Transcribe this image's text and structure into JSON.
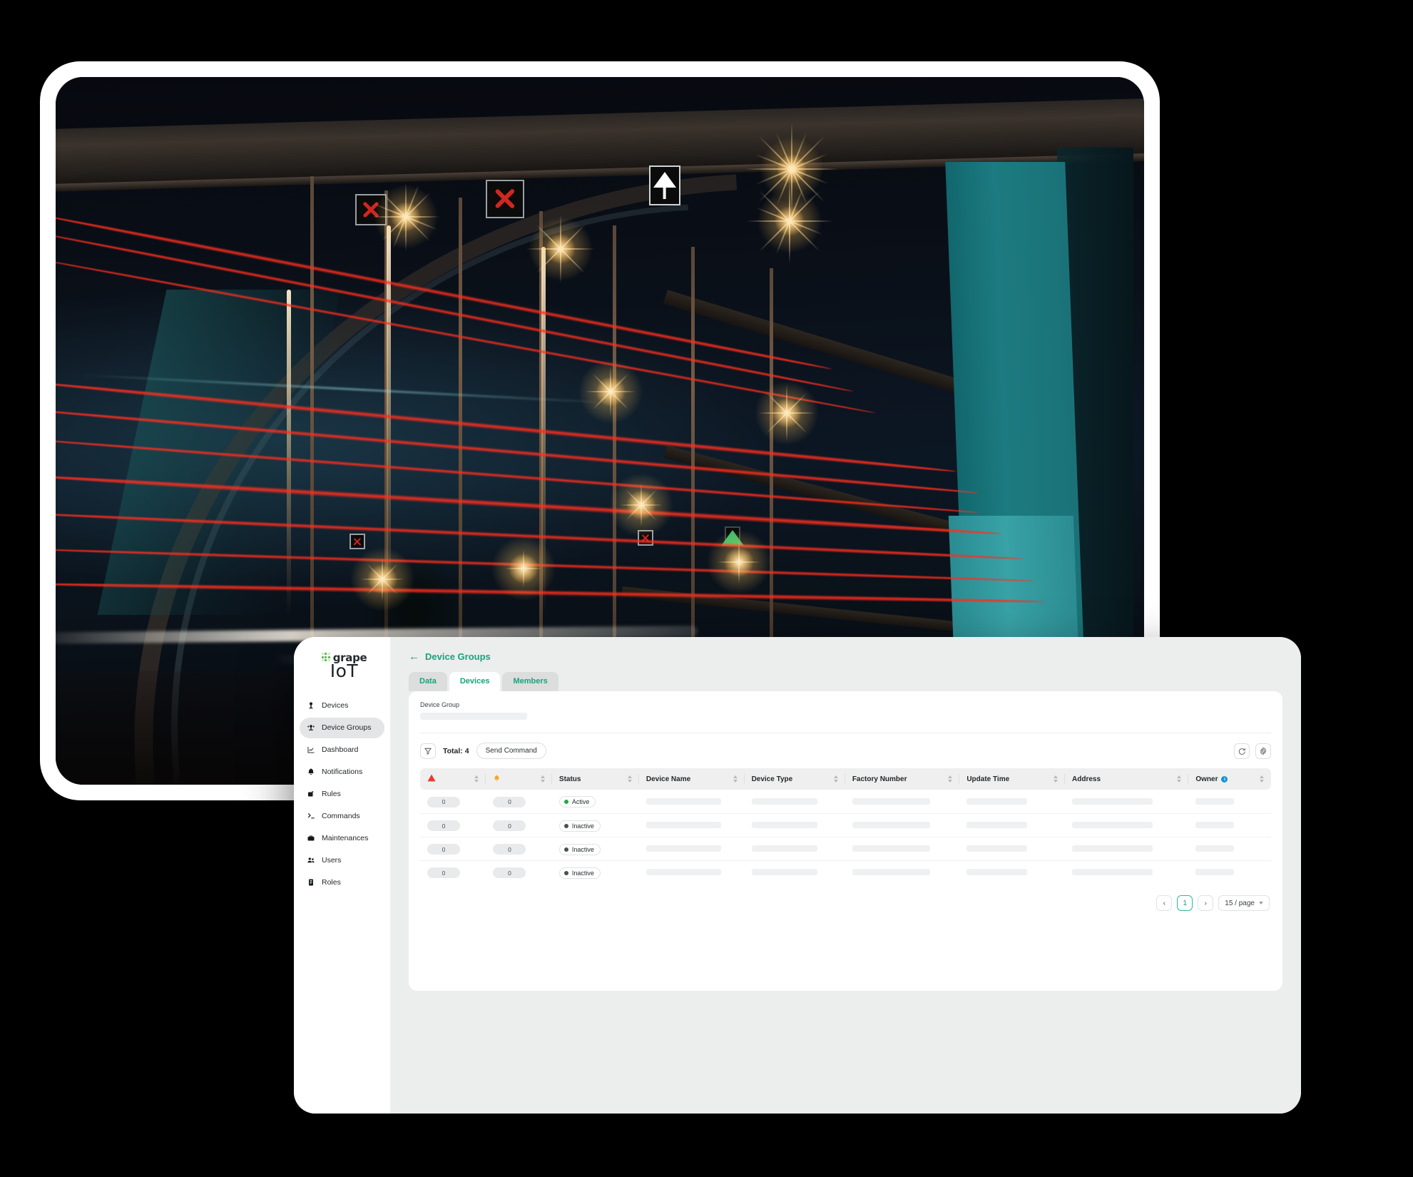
{
  "app": {
    "logo": {
      "word": "grape",
      "product": "IoT",
      "dot_color": "#5bbd4e"
    },
    "accent": "#17a47c"
  },
  "sidebar": {
    "items": [
      {
        "label": "Devices",
        "icon": "device-icon",
        "active": false
      },
      {
        "label": "Device Groups",
        "icon": "device-groups-icon",
        "active": true
      },
      {
        "label": "Dashboard",
        "icon": "chart-icon",
        "active": false
      },
      {
        "label": "Notifications",
        "icon": "bell-icon",
        "active": false
      },
      {
        "label": "Rules",
        "icon": "rules-icon",
        "active": false
      },
      {
        "label": "Commands",
        "icon": "terminal-icon",
        "active": false
      },
      {
        "label": "Maintenances",
        "icon": "toolbox-icon",
        "active": false
      },
      {
        "label": "Users",
        "icon": "users-icon",
        "active": false
      },
      {
        "label": "Roles",
        "icon": "roles-icon",
        "active": false
      }
    ]
  },
  "header": {
    "breadcrumb": "Device Groups",
    "back_icon": "arrow-left-icon"
  },
  "tabs": [
    {
      "label": "Data",
      "active": false
    },
    {
      "label": "Devices",
      "active": true
    },
    {
      "label": "Members",
      "active": false
    }
  ],
  "form": {
    "device_group_label": "Device Group"
  },
  "toolbar": {
    "filter_icon": "filter-icon",
    "total_label": "Total: 4",
    "send_command_label": "Send Command",
    "refresh_icon": "refresh-icon",
    "settings_icon": "gear-icon"
  },
  "table": {
    "columns": [
      {
        "label": "",
        "icon": "alarm-triangle-icon",
        "sortable": true
      },
      {
        "label": "",
        "icon": "bell-icon",
        "sortable": true
      },
      {
        "label": "Status",
        "sortable": true
      },
      {
        "label": "Device Name",
        "sortable": true
      },
      {
        "label": "Device Type",
        "sortable": true
      },
      {
        "label": "Factory Number",
        "sortable": true
      },
      {
        "label": "Update Time",
        "sortable": true
      },
      {
        "label": "Address",
        "sortable": true
      },
      {
        "label": "Owner",
        "icon": "info-icon",
        "sortable": true
      }
    ],
    "rows": [
      {
        "alarms": "0",
        "notifications": "0",
        "status": "Active",
        "status_color": "#1fa94a"
      },
      {
        "alarms": "0",
        "notifications": "0",
        "status": "Inactive",
        "status_color": "#4a4f52"
      },
      {
        "alarms": "0",
        "notifications": "0",
        "status": "Inactive",
        "status_color": "#4a4f52"
      },
      {
        "alarms": "0",
        "notifications": "0",
        "status": "Inactive",
        "status_color": "#4a4f52"
      }
    ]
  },
  "pagination": {
    "prev": "‹",
    "current_page": "1",
    "next": "›",
    "page_size": "15 / page"
  },
  "photo": {
    "description": "night long-exposure photograph of a steel truss bridge with red car light trails, orange starburst street lamps, red X lane-closure signals, white up-arrow lane sign and a teal painted pylon"
  }
}
